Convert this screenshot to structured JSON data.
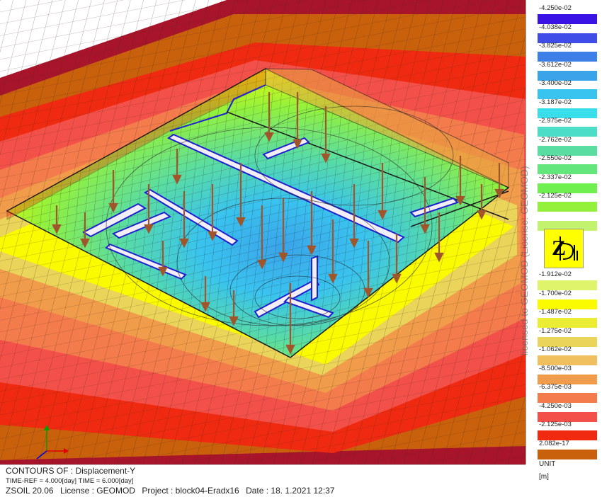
{
  "footer": {
    "contours": "CONTOURS OF : Displacement-Y",
    "time": "TIME-REF = 4.000[day]   TIME = 6.000[day]",
    "software": "ZSOIL 20.06",
    "license": "License :  GEOMOD",
    "project": "Project : block04-Eradx16",
    "date": "Date : 18. 1.2021  12:37"
  },
  "legend": {
    "entries": [
      {
        "label": "-4.250e-02",
        "color": "#3b12e6"
      },
      {
        "label": "-4.038e-02",
        "color": "#3f4ce8"
      },
      {
        "label": "-3.825e-02",
        "color": "#3d7fe6"
      },
      {
        "label": "-3.612e-02",
        "color": "#3aa4ea"
      },
      {
        "label": "-3.400e-02",
        "color": "#39c3ef"
      },
      {
        "label": "-3.187e-02",
        "color": "#38dfea"
      },
      {
        "label": "-2.975e-02",
        "color": "#4cddc6"
      },
      {
        "label": "-2.762e-02",
        "color": "#5adda1"
      },
      {
        "label": "-2.550e-02",
        "color": "#63e67b"
      },
      {
        "label": "-2.337e-02",
        "color": "#6ff04f"
      },
      {
        "label": "-2.125e-02",
        "color": "#93f13c"
      },
      {
        "label": "",
        "color": "#c2f36e"
      },
      {
        "label": "-1.912e-02",
        "color": "#dff36b"
      },
      {
        "label": "-1.700e-02",
        "color": "#fbfb00"
      },
      {
        "label": "-1.487e-02",
        "color": "#ecec33"
      },
      {
        "label": "-1.275e-02",
        "color": "#ead45a"
      },
      {
        "label": "-1.062e-02",
        "color": "#f0c05e"
      },
      {
        "label": "-8.500e-03",
        "color": "#f19c4b"
      },
      {
        "label": "-6.375e-03",
        "color": "#f47b4c"
      },
      {
        "label": "-4.250e-03",
        "color": "#f4504a"
      },
      {
        "label": "-2.125e-03",
        "color": "#ef2a10"
      },
      {
        "label": "2.082e-17",
        "color": "#c8600c"
      }
    ],
    "unit_label": "UNIT",
    "unit_value": "[m]",
    "watermark": "licensed to GEOMOD (License: GEOMOD)",
    "logo_icon": "zsoil-logo-icon"
  }
}
